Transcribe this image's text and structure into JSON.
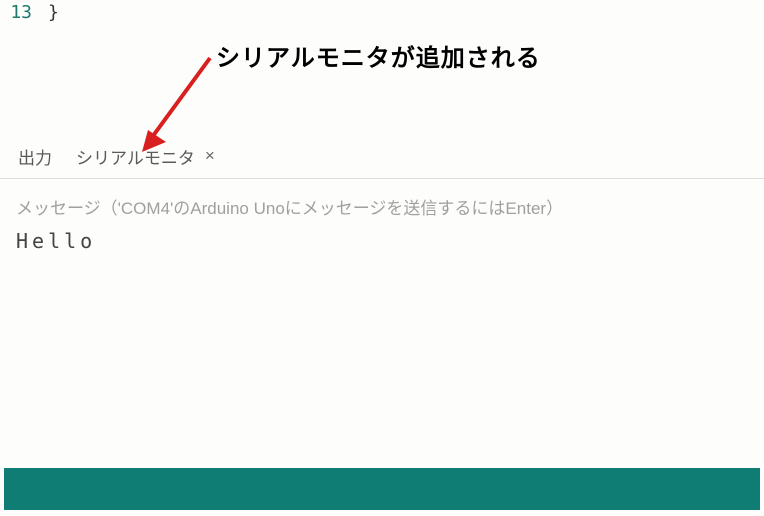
{
  "code": {
    "line_number": "13",
    "content": "}"
  },
  "annotation": {
    "text": "シリアルモニタが追加される"
  },
  "tabs": {
    "output": "出力",
    "serial_monitor": "シリアルモニタ"
  },
  "monitor": {
    "input_placeholder": "メッセージ（'COM4'のArduino Unoにメッセージを送信するにはEnter）",
    "output_text": "Hello"
  }
}
